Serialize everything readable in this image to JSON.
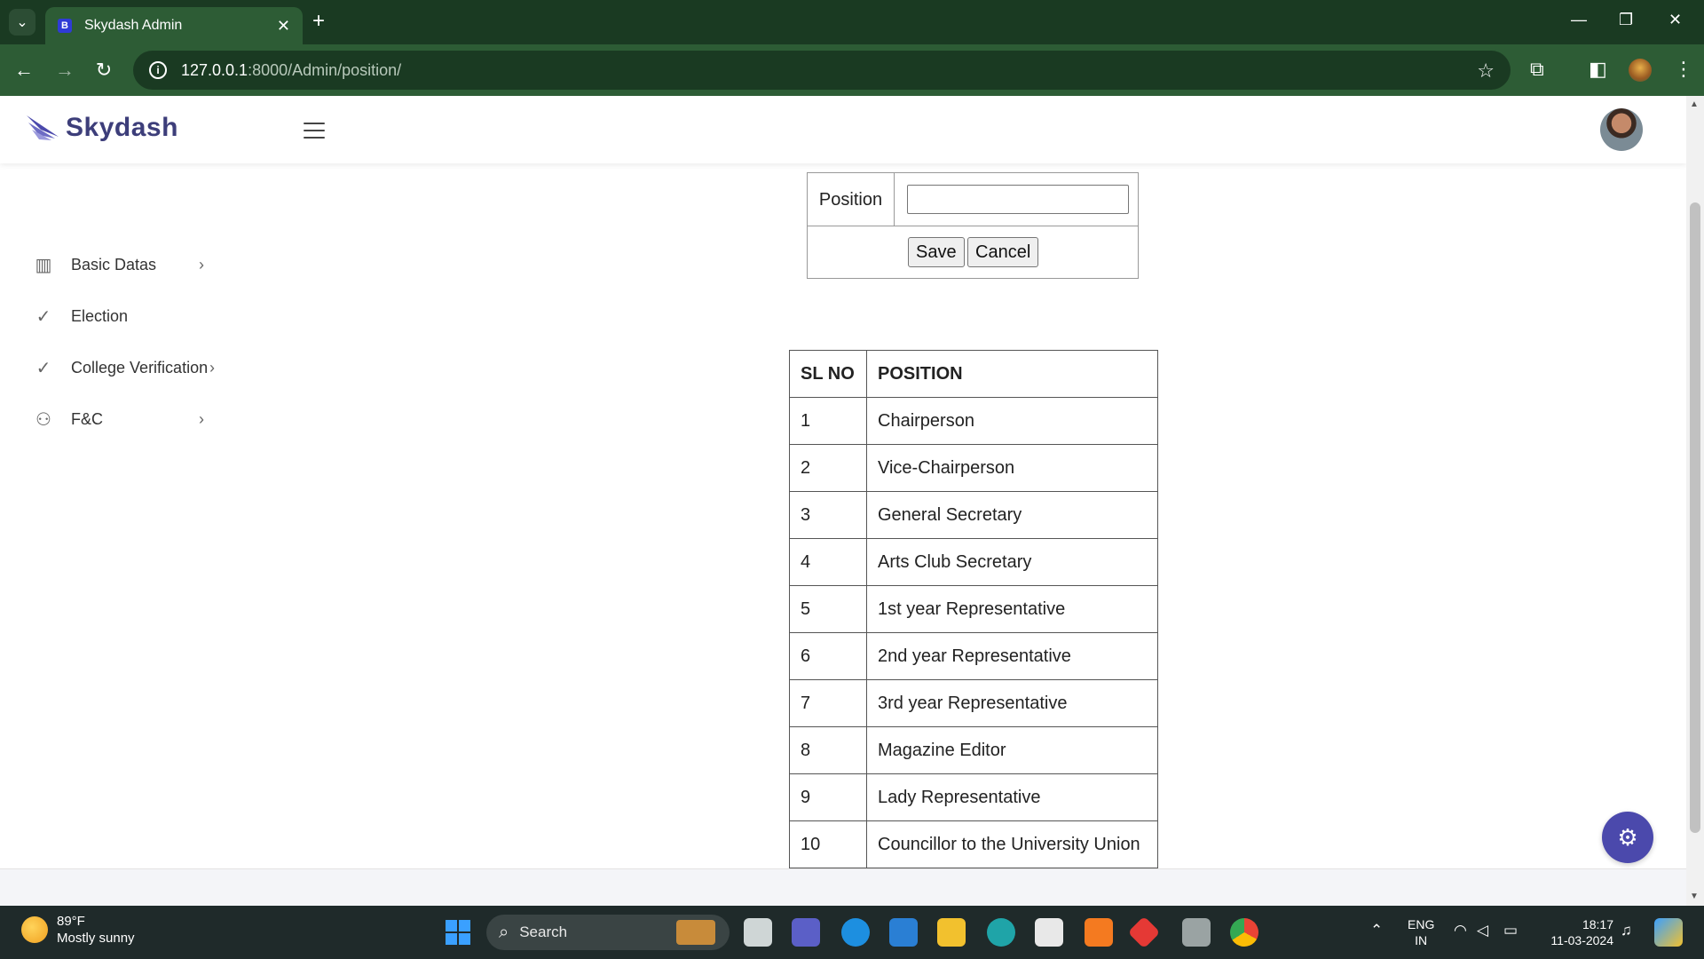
{
  "browser": {
    "tab_title": "Skydash Admin",
    "tab_favicon": "B",
    "tab_close": "✕",
    "new_tab": "+",
    "url_host": "127.0.0.1",
    "url_path": ":8000/Admin/position/"
  },
  "header": {
    "brand": "Skydash"
  },
  "sidebar": {
    "items": [
      {
        "label": "Basic Datas",
        "icon": "columns-icon",
        "has_chevron": true
      },
      {
        "label": "Election",
        "icon": "check-icon",
        "has_chevron": false
      },
      {
        "label": "College Verification",
        "icon": "check-icon",
        "has_chevron": true
      },
      {
        "label": "F&C",
        "icon": "user-icon",
        "has_chevron": true
      }
    ]
  },
  "form": {
    "position_label": "Position",
    "position_value": "",
    "save_label": "Save",
    "cancel_label": "Cancel"
  },
  "table": {
    "headers": [
      "SL NO",
      "POSITION"
    ],
    "rows": [
      [
        "1",
        "Chairperson"
      ],
      [
        "2",
        "Vice-Chairperson"
      ],
      [
        "3",
        "General Secretary"
      ],
      [
        "4",
        "Arts Club Secretary"
      ],
      [
        "5",
        "1st year Representative"
      ],
      [
        "6",
        "2nd year Representative"
      ],
      [
        "7",
        "3rd year Representative"
      ],
      [
        "8",
        "Magazine Editor"
      ],
      [
        "9",
        "Lady Representative"
      ],
      [
        "10",
        "Councillor to the University Union"
      ]
    ]
  },
  "taskbar": {
    "temperature": "89°F",
    "weather": "Mostly sunny",
    "search_label": "Search",
    "lang_line1": "ENG",
    "lang_line2": "IN",
    "time": "18:17",
    "date": "11-03-2024"
  },
  "colors": {
    "accent": "#4b49ac",
    "browser_dark": "#1a3a22",
    "browser_toolbar": "#2d5c35",
    "brand_text": "#3d3e7a"
  }
}
